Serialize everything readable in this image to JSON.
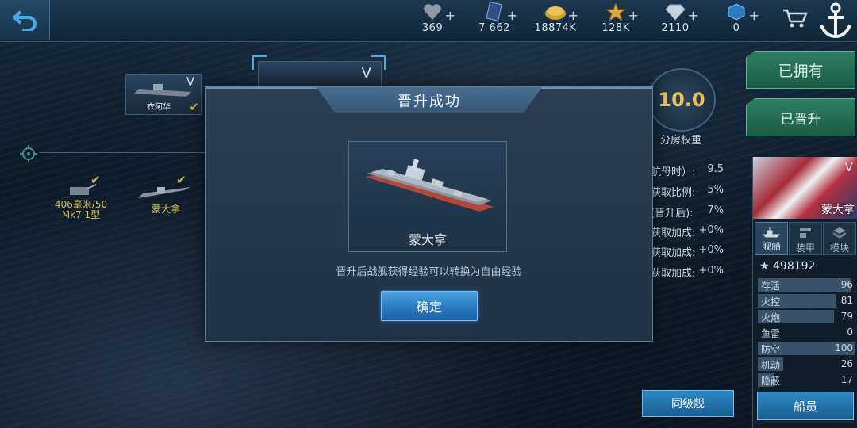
{
  "topbar": {
    "resources": [
      {
        "icon": "heart-icon",
        "value": "369"
      },
      {
        "icon": "card-icon",
        "value": "7 662"
      },
      {
        "icon": "gold-coins-icon",
        "value": "18874K"
      },
      {
        "icon": "star-medal-icon",
        "value": "128K"
      },
      {
        "icon": "diamond-icon",
        "value": "2110"
      },
      {
        "icon": "blue-cube-icon",
        "value": "0"
      }
    ]
  },
  "left_ship": {
    "name": "衣阿华"
  },
  "selected_ship_card": {},
  "slots": {
    "gun_label": "406毫米/50\nMk7 1型",
    "ship_label": "蒙大拿"
  },
  "modal": {
    "title": "晋升成功",
    "ship_name": "蒙大拿",
    "message": "晋升后战舰获得经验可以转换为自由经验",
    "confirm_label": "确定"
  },
  "weight": {
    "value": "10.0",
    "label": "分房权重"
  },
  "stats": [
    {
      "label": "航母时）:",
      "value": "9.5"
    },
    {
      "label": "获取比例:",
      "value": "5%"
    },
    {
      "label": "(晋升后):",
      "value": "7%"
    },
    {
      "label": "获取加成:",
      "value": "+0%"
    },
    {
      "label": "获取加成:",
      "value": "+0%"
    },
    {
      "label": "获取加成:",
      "value": "+0%"
    }
  ],
  "buttons": {
    "owned": "已拥有",
    "promoted": "已晋升",
    "same_tier": "同级舰",
    "crew": "船员"
  },
  "right_panel": {
    "ship_name": "蒙大拿",
    "tabs": [
      "舰船",
      "装甲",
      "模块"
    ],
    "score": "498192",
    "attributes": [
      {
        "name": "存活",
        "value": 96
      },
      {
        "name": "火控",
        "value": 81
      },
      {
        "name": "火炮",
        "value": 79
      },
      {
        "name": "鱼雷",
        "value": 0
      },
      {
        "name": "防空",
        "value": 100
      },
      {
        "name": "机动",
        "value": 26
      },
      {
        "name": "隐蔽",
        "value": 17
      }
    ]
  },
  "colors": {
    "accent_gold": "#e8c35c",
    "button_blue": "#2a79c0",
    "button_green": "#2f7f63"
  }
}
